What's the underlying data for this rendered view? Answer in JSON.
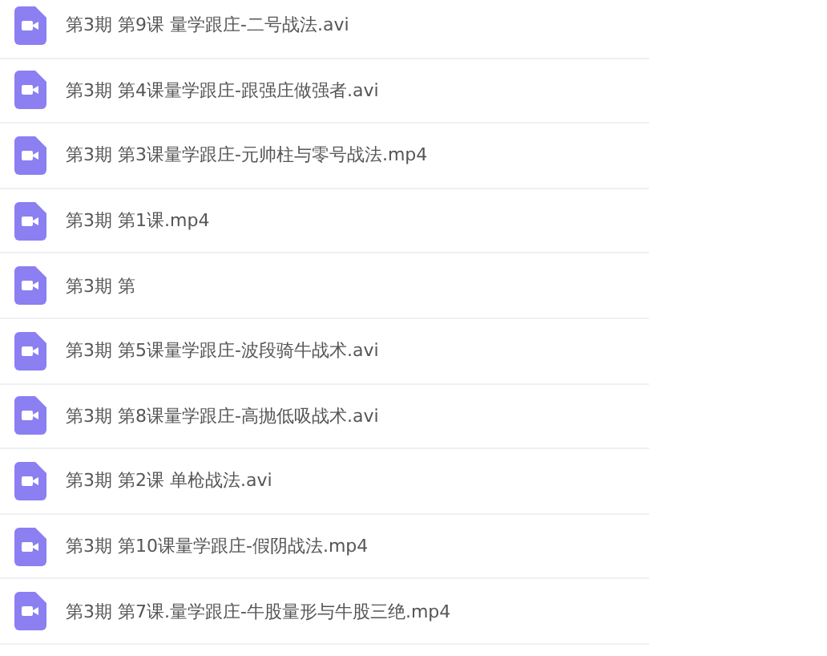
{
  "files": [
    {
      "name": "第3期 第9课 量学跟庄-二号战法.avi"
    },
    {
      "name": "第3期 第4课量学跟庄-跟强庄做强者.avi"
    },
    {
      "name": "第3期 第3课量学跟庄-元帅柱与零号战法.mp4"
    },
    {
      "name": "第3期 第1课.mp4"
    },
    {
      "name": "第3期 第"
    },
    {
      "name": "第3期 第5课量学跟庄-波段骑牛战术.avi"
    },
    {
      "name": "第3期 第8课量学跟庄-高抛低吸战术.avi"
    },
    {
      "name": "第3期 第2课 单枪战法.avi"
    },
    {
      "name": "第3期 第10课量学跟庄-假阴战法.mp4"
    },
    {
      "name": "第3期 第7课.量学跟庄-牛股量形与牛股三绝.mp4"
    }
  ]
}
